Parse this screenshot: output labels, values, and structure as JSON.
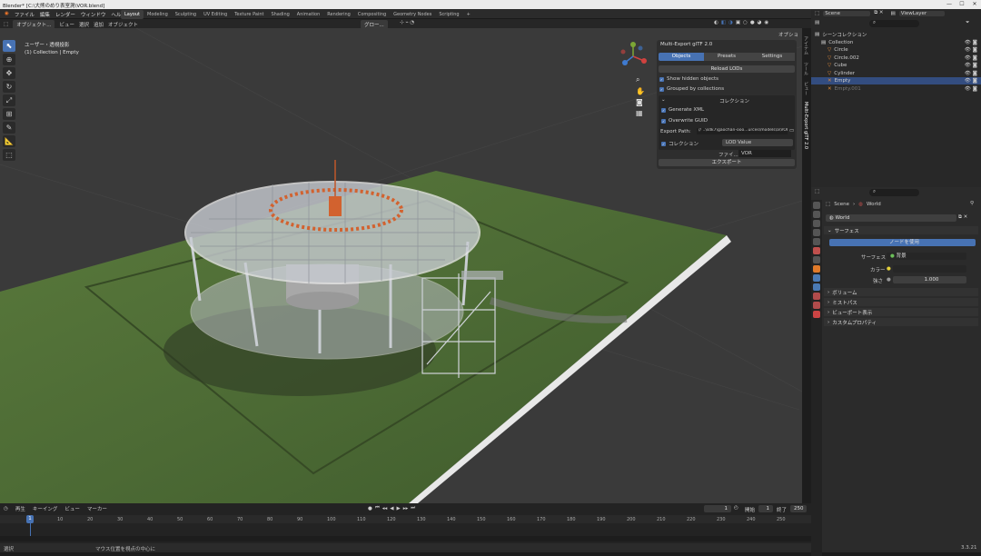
{
  "window": {
    "title": "Blender* [C:\\大熊のめり表室測\\VOR.blend]",
    "min": "—",
    "max": "☐",
    "close": "✕"
  },
  "menu": [
    "ファイル",
    "編集",
    "レンダー",
    "ウィンドウ",
    "ヘルプ"
  ],
  "workspaces": [
    "Layout",
    "Modeling",
    "Sculpting",
    "UV Editing",
    "Texture Paint",
    "Shading",
    "Animation",
    "Rendering",
    "Compositing",
    "Geometry Nodes",
    "Scripting",
    "+"
  ],
  "scene": {
    "name": "Scene",
    "viewlayer": "ViewLayer"
  },
  "header2": {
    "mode": "オブジェクト...",
    "view": "ビュー",
    "select": "選択",
    "add": "追加",
    "object": "オブジェクト",
    "transform": "グロー...",
    "options": "オプション ▾"
  },
  "viewport": {
    "view_name": "ユーザー・透視投影",
    "collection_line": "(1) Collection | Empty"
  },
  "npanel": {
    "title": "Multi-Export glTF 2.0",
    "tabs": [
      "Objects",
      "Presets",
      "Settings"
    ],
    "reload": "Reload LODs",
    "show_hidden": "Show hidden objects",
    "grouped": "Grouped by collections",
    "collection_header": "コレクション",
    "generate_xml": "Generate XML",
    "overwrite_guid": "Overwrite GUID",
    "export_path_label": "Export Path:",
    "export_path_value": "// ..\\sdk7\\gaochan-ooo...urces\\models\\a\\VOR\\",
    "collection_label": "コレクション",
    "lod_value": "LOD Value",
    "file_label": "ファイ...",
    "file_value": "VOR",
    "export_button": "エクスポート"
  },
  "vtabs": [
    "アイテム",
    "ツール",
    "ビュー",
    "Multi-Export glTF 2.0"
  ],
  "outliner": {
    "search": "",
    "items": [
      {
        "name": "シーンコレクション",
        "indent": 0,
        "icon": "collection"
      },
      {
        "name": "Collection",
        "indent": 1,
        "icon": "collection"
      },
      {
        "name": "Circle",
        "indent": 2,
        "icon": "object"
      },
      {
        "name": "Circle.002",
        "indent": 2,
        "icon": "object"
      },
      {
        "name": "Cube",
        "indent": 2,
        "icon": "object"
      },
      {
        "name": "Cylinder",
        "indent": 2,
        "icon": "object"
      },
      {
        "name": "Empty",
        "indent": 2,
        "icon": "empty",
        "selected": true
      },
      {
        "name": "Empty.001",
        "indent": 2,
        "icon": "empty",
        "dim": true
      }
    ]
  },
  "properties": {
    "breadcrumb_scene": "Scene",
    "breadcrumb_world": "World",
    "world_name": "World",
    "surface_header": "サーフェス",
    "use_nodes": "ノードを使用",
    "surface_label": "サーフェス",
    "surface_value": "背景",
    "color_label": "カラー",
    "strength_label": "強さ",
    "strength_value": "1.000",
    "sections": [
      "ボリューム",
      "ミストパス",
      "ビューポート表示",
      "カスタムプロパティ"
    ]
  },
  "timeline": {
    "menu": [
      "再生",
      "キーイング",
      "ビュー",
      "マーカー"
    ],
    "current_frame": "1",
    "start_label": "開始",
    "start": "1",
    "end_label": "終了",
    "end": "250",
    "ticks": [
      "1",
      "10",
      "20",
      "30",
      "40",
      "50",
      "60",
      "70",
      "80",
      "90",
      "100",
      "110",
      "120",
      "130",
      "140",
      "150",
      "160",
      "170",
      "180",
      "190",
      "200",
      "210",
      "220",
      "230",
      "240",
      "250"
    ]
  },
  "status": {
    "left": "選択",
    "middle": "マウス位置を視点の中心に",
    "version": "3.3.21"
  }
}
